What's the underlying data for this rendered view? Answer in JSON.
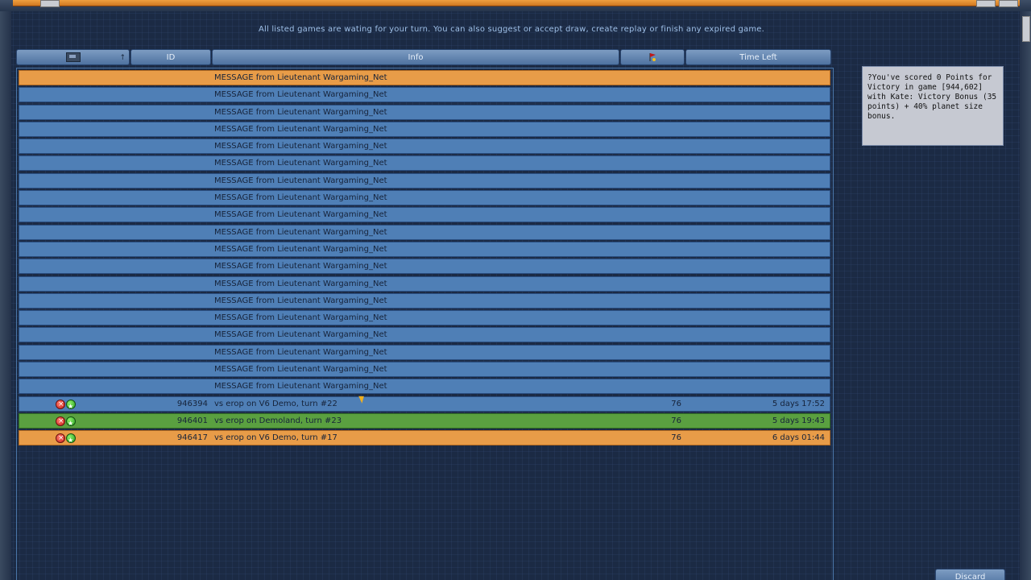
{
  "notice": "All listed games are wating for your turn. You can also suggest or accept draw, create replay or finish any expired game.",
  "headers": {
    "col1_icon": "monitor-icon",
    "col1_arrow": "↑",
    "id": "ID",
    "info": "Info",
    "points_icon": "flag-icon",
    "time_left": "Time Left"
  },
  "messages": [
    "MESSAGE from Lieutenant Wargaming_Net",
    "MESSAGE from Lieutenant Wargaming_Net",
    "MESSAGE from Lieutenant Wargaming_Net",
    "MESSAGE from Lieutenant Wargaming_Net",
    "MESSAGE from Lieutenant Wargaming_Net",
    "MESSAGE from Lieutenant Wargaming_Net",
    "MESSAGE from Lieutenant Wargaming_Net",
    "MESSAGE from Lieutenant Wargaming_Net",
    "MESSAGE from Lieutenant Wargaming_Net",
    "MESSAGE from Lieutenant Wargaming_Net",
    "MESSAGE from Lieutenant Wargaming_Net",
    "MESSAGE from Lieutenant Wargaming_Net",
    "MESSAGE from Lieutenant Wargaming_Net",
    "MESSAGE from Lieutenant Wargaming_Net",
    "MESSAGE from Lieutenant Wargaming_Net",
    "MESSAGE from Lieutenant Wargaming_Net",
    "MESSAGE from Lieutenant Wargaming_Net",
    "MESSAGE from Lieutenant Wargaming_Net",
    "MESSAGE from Lieutenant Wargaming_Net"
  ],
  "games": [
    {
      "id": "946394",
      "info": "vs erop on V6 Demo, turn #22",
      "points": "76",
      "time_left": "5 days 17:52",
      "state": "normal"
    },
    {
      "id": "946401",
      "info": "vs erop on Demoland, turn #23",
      "points": "76",
      "time_left": "5 days 19:43",
      "state": "green"
    },
    {
      "id": "946417",
      "info": "vs erop on V6 Demo, turn #17",
      "points": "76",
      "time_left": "6 days 01:44",
      "state": "orange"
    }
  ],
  "sidebox": {
    "text": "?You've scored 0 Points for Victory in game [944,602] with Kate: Victory Bonus (35 points) + 40% planet size bonus."
  },
  "buttons": {
    "discard": "Discard"
  },
  "colors": {
    "row_blue": "#4f7fb6",
    "row_orange": "#e89c48",
    "row_green": "#5aa040"
  }
}
